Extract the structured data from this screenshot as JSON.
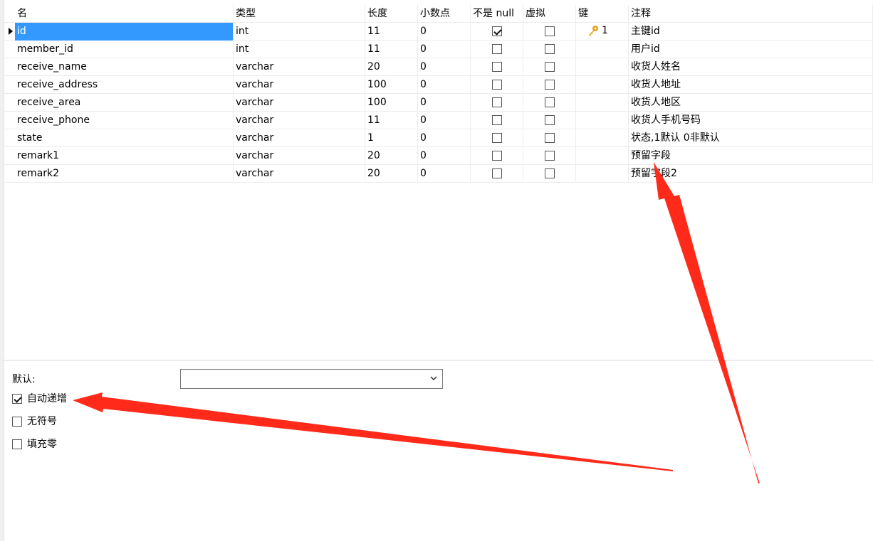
{
  "columns": [
    "名",
    "类型",
    "长度",
    "小数点",
    "不是 null",
    "虚拟",
    "键",
    "注释"
  ],
  "rows": [
    {
      "name": "id",
      "type": "int",
      "length": "11",
      "decimals": "0",
      "not_null": true,
      "virtual": false,
      "key": "1",
      "comment": "主键id"
    },
    {
      "name": "member_id",
      "type": "int",
      "length": "11",
      "decimals": "0",
      "not_null": false,
      "virtual": false,
      "key": "",
      "comment": "用户id"
    },
    {
      "name": "receive_name",
      "type": "varchar",
      "length": "20",
      "decimals": "0",
      "not_null": false,
      "virtual": false,
      "key": "",
      "comment": "收货人姓名"
    },
    {
      "name": "receive_address",
      "type": "varchar",
      "length": "100",
      "decimals": "0",
      "not_null": false,
      "virtual": false,
      "key": "",
      "comment": "收货人地址"
    },
    {
      "name": "receive_area",
      "type": "varchar",
      "length": "100",
      "decimals": "0",
      "not_null": false,
      "virtual": false,
      "key": "",
      "comment": "收货人地区"
    },
    {
      "name": "receive_phone",
      "type": "varchar",
      "length": "11",
      "decimals": "0",
      "not_null": false,
      "virtual": false,
      "key": "",
      "comment": "收货人手机号码"
    },
    {
      "name": "state",
      "type": "varchar",
      "length": "1",
      "decimals": "0",
      "not_null": false,
      "virtual": false,
      "key": "",
      "comment": "状态,1默认 0非默认"
    },
    {
      "name": "remark1",
      "type": "varchar",
      "length": "20",
      "decimals": "0",
      "not_null": false,
      "virtual": false,
      "key": "",
      "comment": "预留字段"
    },
    {
      "name": "remark2",
      "type": "varchar",
      "length": "20",
      "decimals": "0",
      "not_null": false,
      "virtual": false,
      "key": "",
      "comment": "预留字段2"
    }
  ],
  "selected_row": 0,
  "properties": {
    "default_label": "默认:",
    "default_value": "",
    "options": [
      {
        "label": "自动递增",
        "checked": true
      },
      {
        "label": "无符号",
        "checked": false
      },
      {
        "label": "填充零",
        "checked": false
      }
    ]
  },
  "colors": {
    "selection": "#3399ff",
    "annotation_arrow": "#ff2a1a",
    "key_icon": "#e3a21a"
  },
  "icons": {
    "row_marker": "current-row-triangle-icon",
    "key": "key-icon",
    "dropdown": "chevron-down-icon"
  }
}
